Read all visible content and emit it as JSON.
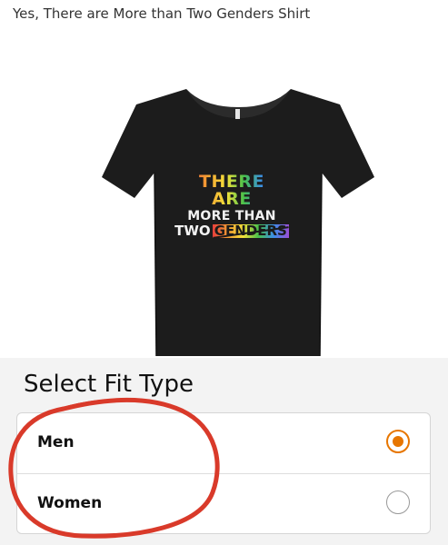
{
  "product": {
    "title": "Yes, There are More than Two Genders Shirt",
    "image_icon": "tshirt-icon",
    "print": {
      "line1": "THERE ARE",
      "line2": "MORE THAN",
      "line3_a": "TWO",
      "line3_b": "GENDERS"
    },
    "shirt_color": "#1c1c1c"
  },
  "fit_selector": {
    "heading": "Select Fit Type",
    "options": [
      {
        "label": "Men",
        "selected": true
      },
      {
        "label": "Women",
        "selected": false
      }
    ],
    "accent_color": "#e77600"
  },
  "annotation": {
    "color": "#d93a2a"
  }
}
